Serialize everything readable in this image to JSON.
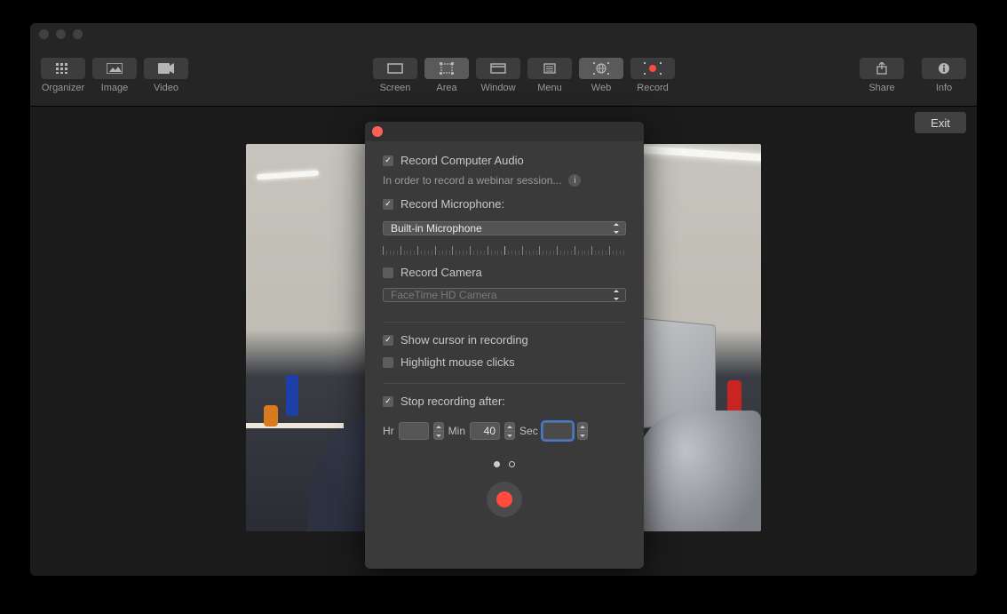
{
  "toolbar": {
    "organizer": "Organizer",
    "image": "Image",
    "video": "Video",
    "screen": "Screen",
    "area": "Area",
    "window": "Window",
    "menu": "Menu",
    "web": "Web",
    "record": "Record",
    "share": "Share",
    "info": "Info"
  },
  "exit": {
    "label": "Exit"
  },
  "popover": {
    "record_audio": {
      "label": "Record Computer Audio",
      "checked": true
    },
    "audio_subtext": "In order to record a webinar session...",
    "record_mic": {
      "label": "Record Microphone:",
      "checked": true
    },
    "mic_select": {
      "value": "Built-in Microphone"
    },
    "record_camera": {
      "label": "Record Camera",
      "checked": false
    },
    "camera_select": {
      "value": "FaceTime HD Camera"
    },
    "show_cursor": {
      "label": "Show cursor in recording",
      "checked": true
    },
    "highlight_clicks": {
      "label": "Highlight mouse clicks",
      "checked": false
    },
    "stop_after": {
      "label": "Stop recording after:",
      "checked": true
    },
    "time": {
      "hr_label": "Hr",
      "hr_value": "",
      "min_label": "Min",
      "min_value": "40",
      "sec_label": "Sec",
      "sec_value": ""
    },
    "pager": {
      "total": 2,
      "active": 0
    }
  }
}
